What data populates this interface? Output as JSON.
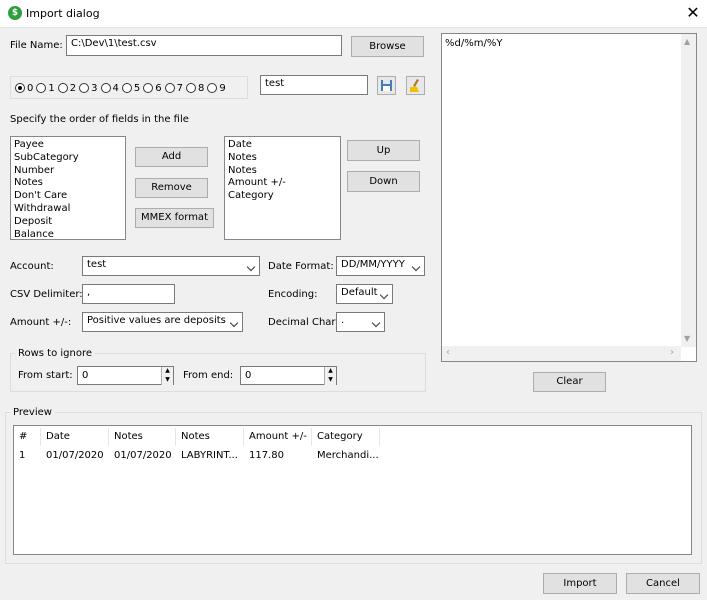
{
  "window": {
    "title": "Import dialog",
    "close_glyph": "✕"
  },
  "file": {
    "label": "File Name:",
    "value": "C:\\Dev\\1\\test.csv",
    "browse_label": "Browse"
  },
  "presets": {
    "options": [
      "0",
      "1",
      "2",
      "3",
      "4",
      "5",
      "6",
      "7",
      "8",
      "9"
    ],
    "selected": "0",
    "name_value": "test"
  },
  "fields": {
    "instruction": "Specify the order of fields in the file",
    "available": [
      "Payee",
      "SubCategory",
      "Number",
      "Notes",
      "Don't Care",
      "Withdrawal",
      "Deposit",
      "Balance"
    ],
    "selected": [
      "Date",
      "Notes",
      "Notes",
      "Amount +/-",
      "Category"
    ],
    "add_label": "Add",
    "remove_label": "Remove",
    "mmex_label": "MMEX format",
    "up_label": "Up",
    "down_label": "Down"
  },
  "settings": {
    "account_label": "Account:",
    "account_value": "test",
    "date_format_label": "Date Format:",
    "date_format_value": "DD/MM/YYYY",
    "csv_delim_label": "CSV Delimiter:",
    "csv_delim_value": ",",
    "encoding_label": "Encoding:",
    "encoding_value": "Default",
    "amount_label": "Amount +/-:",
    "amount_value": "Positive values are deposits",
    "decimal_label": "Decimal Char",
    "decimal_value": "."
  },
  "rows_ignore": {
    "title": "Rows to ignore",
    "start_label": "From start:",
    "start_value": "0",
    "end_label": "From end:",
    "end_value": "0"
  },
  "date_mask": {
    "text": "%d/%m/%Y",
    "clear_label": "Clear"
  },
  "preview": {
    "title": "Preview",
    "columns": [
      "#",
      "Date",
      "Notes",
      "Notes",
      "Amount +/-",
      "Category"
    ],
    "rows": [
      [
        "1",
        "01/07/2020",
        "01/07/2020",
        "LABYRINT...",
        "117.80",
        "Merchandi..."
      ]
    ]
  },
  "footer": {
    "import_label": "Import",
    "cancel_label": "Cancel"
  },
  "colors": {
    "app_icon": "#2e9e3e",
    "background": "#f0f0f0"
  }
}
